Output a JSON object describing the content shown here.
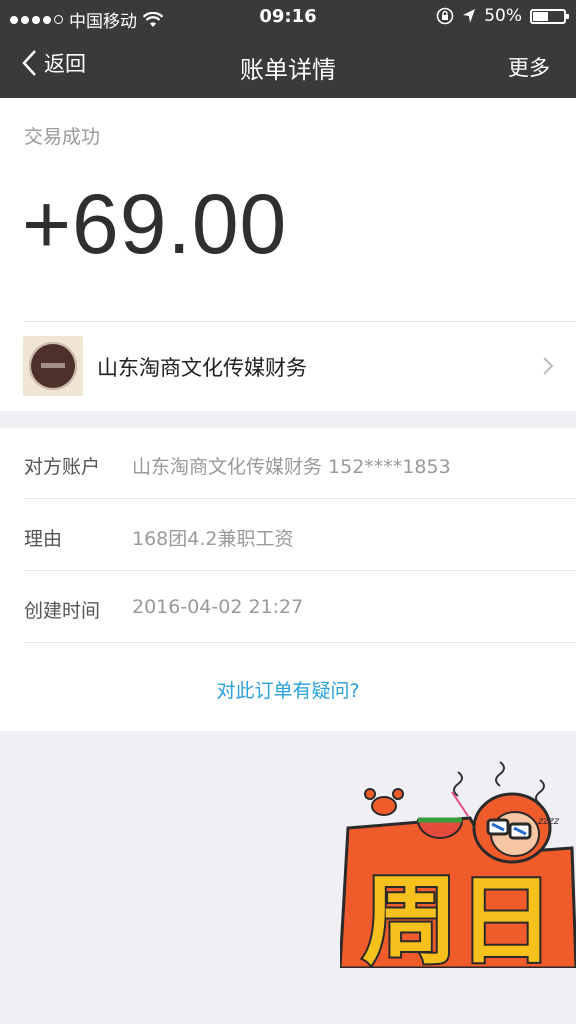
{
  "status_bar": {
    "carrier": "中国移动",
    "time": "09:16",
    "battery": "50%",
    "battery_level": 0.5
  },
  "nav": {
    "back_label": "返回",
    "title": "账单详情",
    "more_label": "更多"
  },
  "transaction": {
    "status": "交易成功",
    "amount": "+69.00"
  },
  "merchant": {
    "name": "山东淘商文化传媒财务"
  },
  "details": [
    {
      "label": "对方账户",
      "value": "山东淘商文化传媒财务 152****1853"
    },
    {
      "label": "理由",
      "value": "168团4.2兼职工资"
    },
    {
      "label": "创建时间",
      "value": "2016-04-02 21:27"
    }
  ],
  "question_link": "对此订单有疑问?",
  "sticker": {
    "text": "周日",
    "snore": "zzzz"
  },
  "colors": {
    "nav_bg": "#3a3a3a",
    "link": "#2aa0dc",
    "background": "#efeff4"
  }
}
